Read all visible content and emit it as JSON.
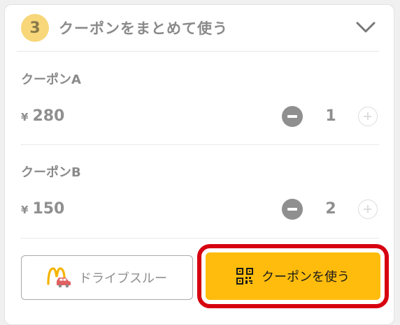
{
  "header": {
    "step_number": "3",
    "title": "クーポンをまとめて使う"
  },
  "coupons": [
    {
      "name": "クーポンA",
      "currency": "¥",
      "price": "280",
      "quantity": "1"
    },
    {
      "name": "クーポンB",
      "currency": "¥",
      "price": "150",
      "quantity": "2"
    }
  ],
  "actions": {
    "drive_thru_label": "ドライブスルー",
    "use_coupon_label": "クーポンを使う"
  },
  "colors": {
    "accent_yellow": "#ffbc0d",
    "highlight_red": "#d6000f",
    "text_gray": "#8f8f8f",
    "badge_yellow": "#f7d77a"
  },
  "icons": {
    "collapse": "chevron-down-icon",
    "drive_thru": "mcdonalds-drive-thru-icon",
    "qr": "qr-code-icon"
  }
}
